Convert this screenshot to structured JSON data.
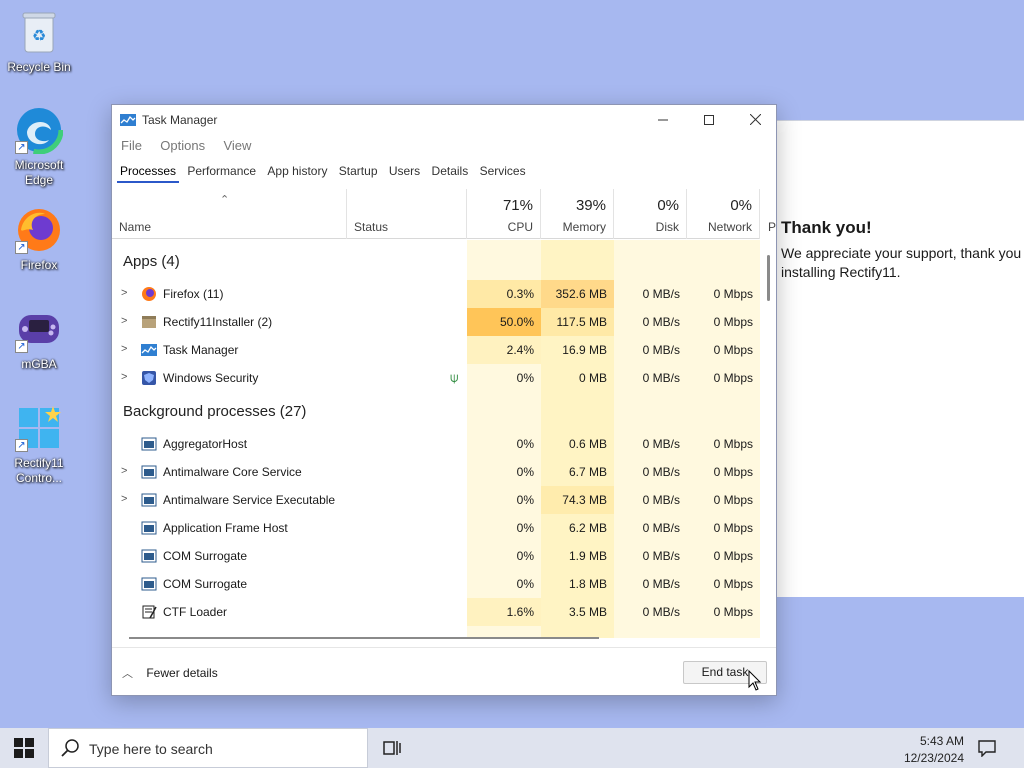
{
  "desktop": {
    "icons": [
      {
        "label": "Recycle Bin"
      },
      {
        "label": "Microsoft Edge"
      },
      {
        "label": "Firefox"
      },
      {
        "label": "mGBA"
      },
      {
        "label": "Rectify11 Contro..."
      }
    ]
  },
  "bg_window": {
    "title": "Thank you!",
    "message": "We appreciate your support, thank you installing Rectify11."
  },
  "task_manager": {
    "title": "Task Manager",
    "menu": [
      "File",
      "Options",
      "View"
    ],
    "tabs": [
      "Processes",
      "Performance",
      "App history",
      "Startup",
      "Users",
      "Details",
      "Services"
    ],
    "active_tab": "Processes",
    "columns": {
      "name": "Name",
      "status": "Status",
      "cpu": {
        "label": "CPU",
        "pct": "71%"
      },
      "memory": {
        "label": "Memory",
        "pct": "39%"
      },
      "disk": {
        "label": "Disk",
        "pct": "0%"
      },
      "network": {
        "label": "Network",
        "pct": "0%"
      },
      "power": "P"
    },
    "groups": {
      "apps": "Apps (4)",
      "background": "Background processes (27)"
    },
    "apps": [
      {
        "name": "Firefox (11)",
        "cpu": "0.3%",
        "memory": "352.6 MB",
        "disk": "0 MB/s",
        "network": "0 Mbps",
        "icon": "firefox-icon"
      },
      {
        "name": "Rectify11Installer (2)",
        "cpu": "50.0%",
        "memory": "117.5 MB",
        "disk": "0 MB/s",
        "network": "0 Mbps",
        "icon": "installer-icon"
      },
      {
        "name": "Task Manager",
        "cpu": "2.4%",
        "memory": "16.9 MB",
        "disk": "0 MB/s",
        "network": "0 Mbps",
        "icon": "task-manager-icon"
      },
      {
        "name": "Windows Security",
        "cpu": "0%",
        "memory": "0 MB",
        "disk": "0 MB/s",
        "network": "0 Mbps",
        "icon": "shield-icon"
      }
    ],
    "background": [
      {
        "name": "AggregatorHost",
        "cpu": "0%",
        "memory": "0.6 MB",
        "disk": "0 MB/s",
        "network": "0 Mbps"
      },
      {
        "name": "Antimalware Core Service",
        "cpu": "0%",
        "memory": "6.7 MB",
        "disk": "0 MB/s",
        "network": "0 Mbps"
      },
      {
        "name": "Antimalware Service Executable",
        "cpu": "0%",
        "memory": "74.3 MB",
        "disk": "0 MB/s",
        "network": "0 Mbps"
      },
      {
        "name": "Application Frame Host",
        "cpu": "0%",
        "memory": "6.2 MB",
        "disk": "0 MB/s",
        "network": "0 Mbps"
      },
      {
        "name": "COM Surrogate",
        "cpu": "0%",
        "memory": "1.9 MB",
        "disk": "0 MB/s",
        "network": "0 Mbps"
      },
      {
        "name": "COM Surrogate",
        "cpu": "0%",
        "memory": "1.8 MB",
        "disk": "0 MB/s",
        "network": "0 Mbps"
      },
      {
        "name": "CTF Loader",
        "cpu": "1.6%",
        "memory": "3.5 MB",
        "disk": "0 MB/s",
        "network": "0 Mbps"
      }
    ],
    "footer": {
      "fewer_details": "Fewer details",
      "end_task": "End task"
    }
  },
  "taskbar": {
    "search_placeholder": "Type here to search",
    "time": "5:43 AM",
    "date": "12/23/2024"
  },
  "colors": {
    "desktop_bg": "#a7b8f0",
    "heat_light": "#fff4c4",
    "heat_medium": "#ffe69a",
    "heat_high": "#ffd076",
    "accent": "#2b58c9"
  }
}
